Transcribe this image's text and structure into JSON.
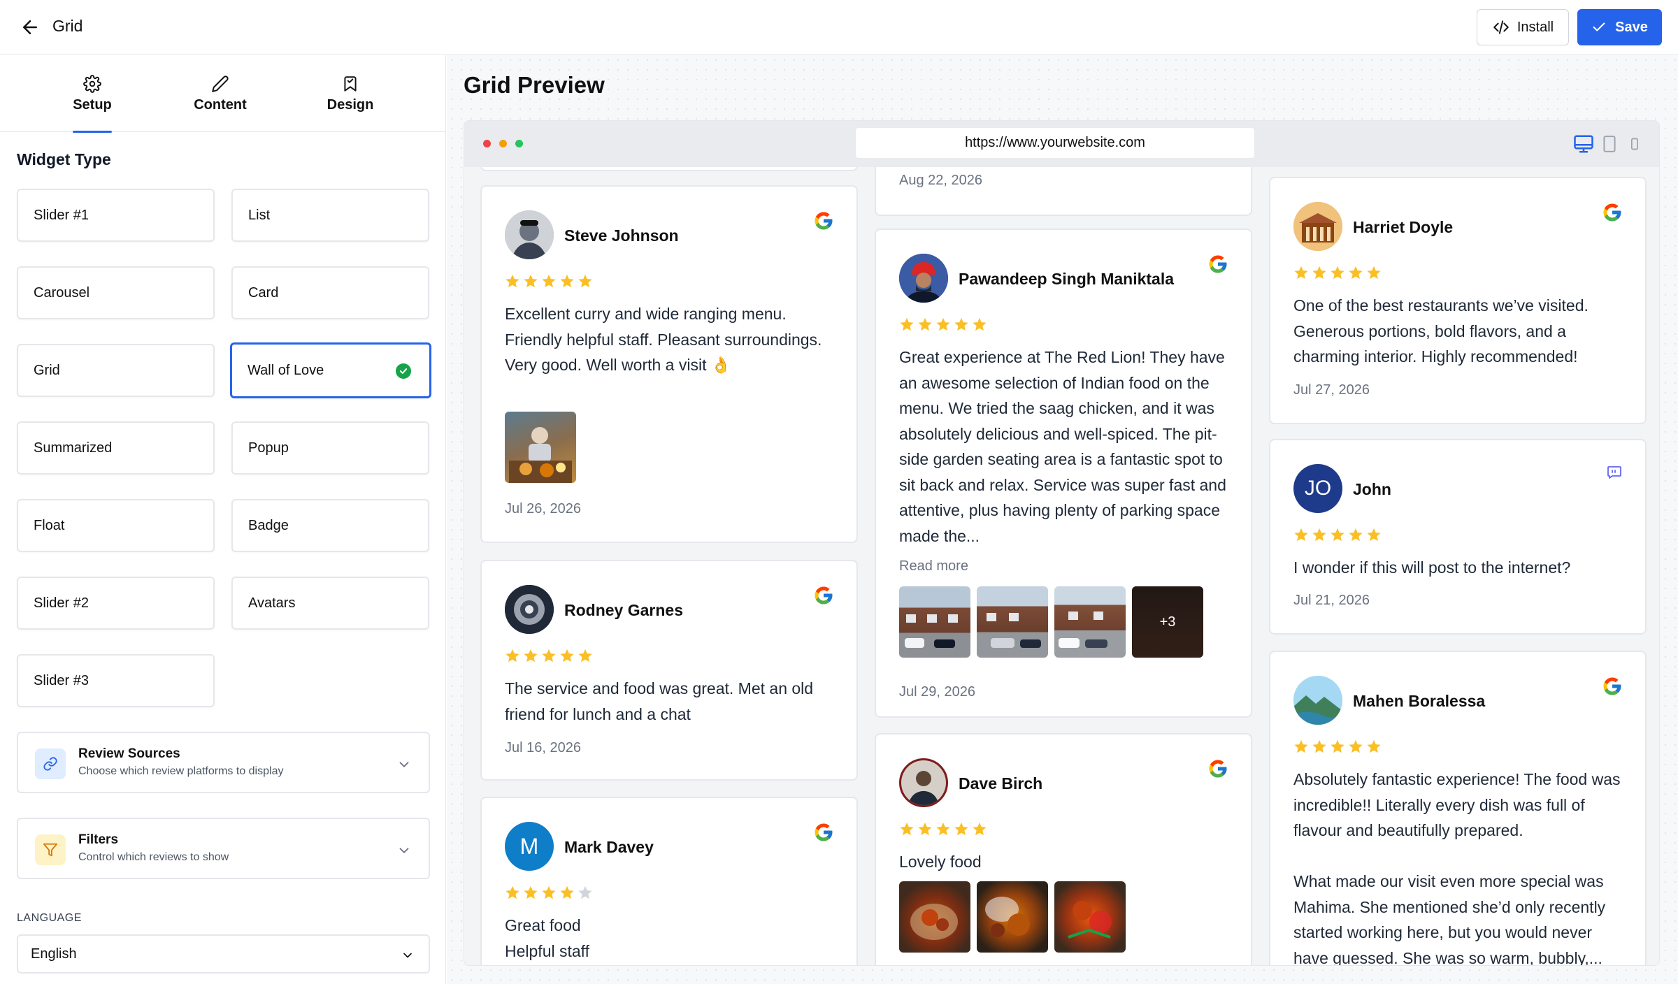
{
  "topbar": {
    "title": "Grid",
    "install_label": "Install",
    "save_label": "Save"
  },
  "tabs": [
    {
      "label": "Setup",
      "icon": "gear-icon",
      "active": true
    },
    {
      "label": "Content",
      "icon": "pencil-icon",
      "active": false
    },
    {
      "label": "Design",
      "icon": "bookmark-icon",
      "active": false
    }
  ],
  "widget_type": {
    "label": "Widget Type",
    "options": [
      "Slider #1",
      "List",
      "Carousel",
      "Card",
      "Grid",
      "Wall of Love",
      "Summarized",
      "Popup",
      "Float",
      "Badge",
      "Slider #2",
      "Avatars",
      "Slider #3"
    ],
    "selected": "Wall of Love"
  },
  "review_sources": {
    "title": "Review Sources",
    "subtitle": "Choose which review platforms to display"
  },
  "filters": {
    "title": "Filters",
    "subtitle": "Control which reviews to show"
  },
  "language": {
    "label": "LANGUAGE",
    "value": "English"
  },
  "preview": {
    "title": "Grid Preview",
    "url": "https://www.yourwebsite.com"
  },
  "colors": {
    "accent": "#2563eb",
    "star": "#fbbf24",
    "selected_check": "#16a34a"
  },
  "reviews": {
    "col2_top_date": "Aug 22, 2026",
    "steve": {
      "name": "Steve Johnson",
      "rating": 5,
      "text": "Excellent curry and wide ranging menu. Friendly helpful staff. Pleasant surroundings. Very good. Well worth a visit 👌",
      "date": "Jul 26, 2026",
      "source": "google-icon"
    },
    "rodney": {
      "name": "Rodney Garnes",
      "rating": 5,
      "text": "The service and food was great. Met an old friend for lunch and a chat",
      "date": "Jul 16, 2026",
      "source": "google-icon"
    },
    "mark": {
      "name": "Mark Davey",
      "initial": "M",
      "rating": 4,
      "text": "Great food\nHelpful staff",
      "source": "google-icon"
    },
    "pawandeep": {
      "name": "Pawandeep Singh Maniktala",
      "rating": 5,
      "text": "Great experience at The Red Lion! They have an awesome selection of Indian food on the menu. We tried the saag chicken, and it was absolutely delicious and well-spiced. The pit-side garden seating area is a fantastic spot to sit back and relax. Service was super fast and attentive, plus having plenty of parking space made the...",
      "read_more": "Read more",
      "more_photos": "+3",
      "date": "Jul 29, 2026",
      "source": "google-icon"
    },
    "dave": {
      "name": "Dave Birch",
      "rating": 5,
      "text": "Lovely food",
      "source": "google-icon"
    },
    "harriet": {
      "name": "Harriet Doyle",
      "rating": 5,
      "text": "One of the best restaurants we’ve visited. Generous portions, bold flavors, and a charming interior. Highly recommended!",
      "date": "Jul 27, 2026",
      "source": "google-icon"
    },
    "john": {
      "name": "John",
      "initials": "JO",
      "rating": 5,
      "text": "I wonder if this will post to the internet?",
      "date": "Jul 21, 2026",
      "source": "chat-bubble-icon"
    },
    "mahen": {
      "name": "Mahen Boralessa",
      "rating": 5,
      "text": "Absolutely fantastic experience! The food was incredible!! Literally every dish was full of flavour and beautifully prepared.\n\nWhat made our visit even more special was Mahima. She mentioned she’d only recently started working here, but you would never have guessed. She was so warm, bubbly,...",
      "source": "google-icon"
    }
  }
}
